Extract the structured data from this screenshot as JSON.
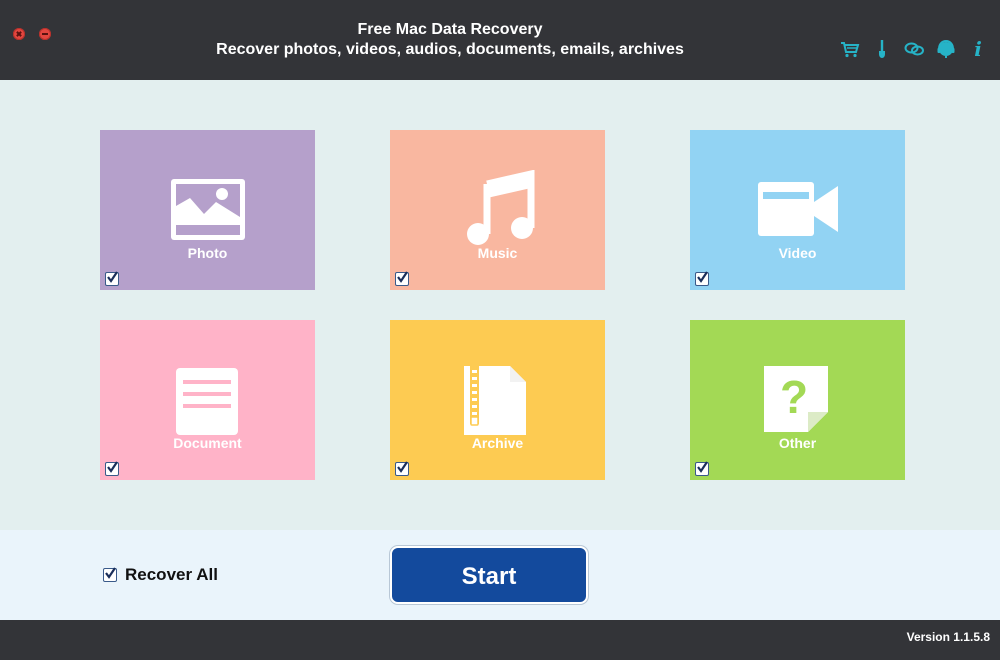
{
  "window": {
    "title": "Free Mac Data Recovery",
    "subtitle": "Recover photos, videos, audios, documents, emails, archives"
  },
  "toolbar": {
    "icons": [
      "cart-icon",
      "brush-icon",
      "chat-icon",
      "support-icon",
      "info-icon"
    ],
    "info_glyph": "i",
    "accent_color": "#26b3c7"
  },
  "tiles": [
    {
      "label": "Photo",
      "color": "#b5a0cb",
      "icon": "photo-icon",
      "checked": true
    },
    {
      "label": "Music",
      "color": "#f9b7a0",
      "icon": "music-icon",
      "checked": true
    },
    {
      "label": "Video",
      "color": "#92d3f3",
      "icon": "video-icon",
      "checked": true
    },
    {
      "label": "Document",
      "color": "#ffb3c8",
      "icon": "document-icon",
      "checked": true
    },
    {
      "label": "Archive",
      "color": "#fdcb52",
      "icon": "archive-icon",
      "checked": true
    },
    {
      "label": "Other",
      "color": "#a3d955",
      "icon": "question-file-icon",
      "checked": true
    }
  ],
  "footer": {
    "recover_all_label": "Recover All",
    "recover_all_checked": true,
    "start_label": "Start",
    "start_color": "#134a9d",
    "version": "Version 1.1.5.8"
  }
}
